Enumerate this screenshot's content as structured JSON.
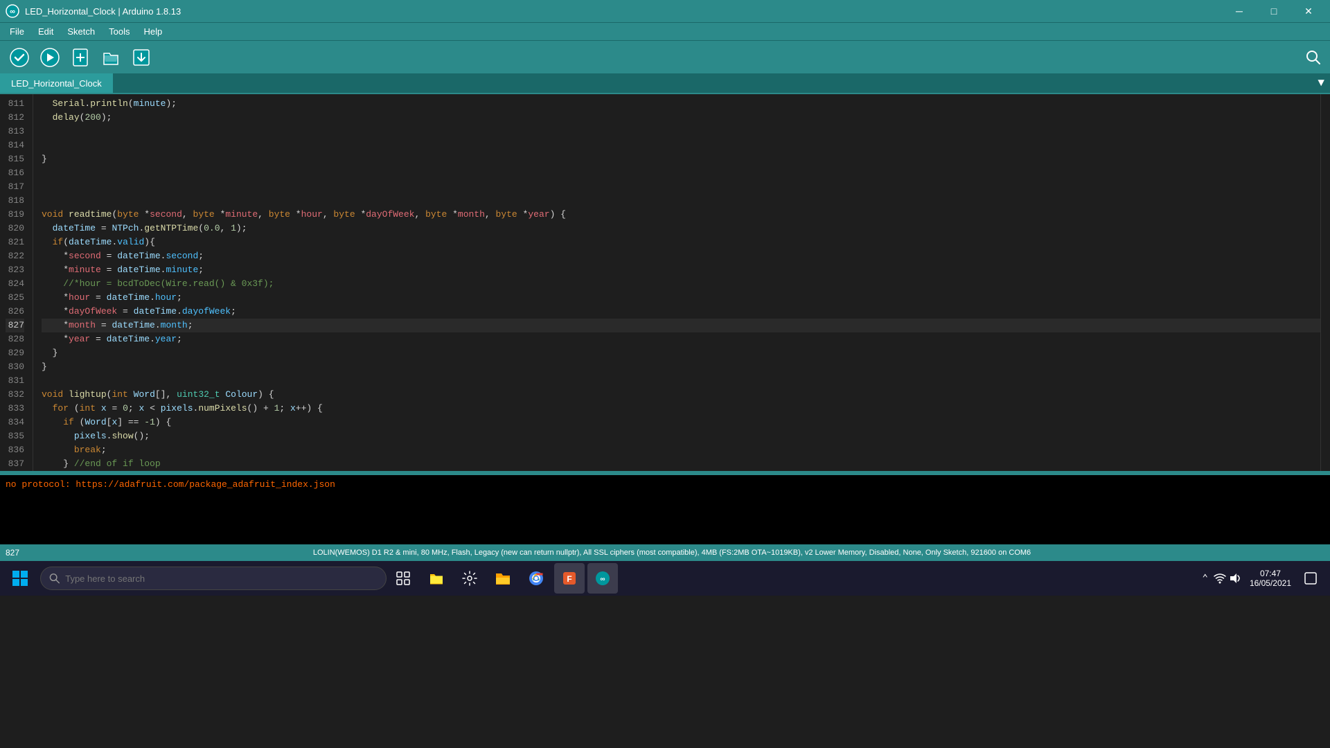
{
  "titlebar": {
    "title": "LED_Horizontal_Clock | Arduino 1.8.13",
    "icon": "arduino"
  },
  "window_controls": {
    "minimize": "─",
    "maximize": "□",
    "close": "✕"
  },
  "menu": {
    "items": [
      "File",
      "Edit",
      "Sketch",
      "Tools",
      "Help"
    ]
  },
  "tab": {
    "label": "LED_Horizontal_Clock",
    "active": true
  },
  "code_lines": [
    {
      "num": "811",
      "content": "  Serial.println(minute);"
    },
    {
      "num": "812",
      "content": "  delay(200);"
    },
    {
      "num": "813",
      "content": ""
    },
    {
      "num": "814",
      "content": ""
    },
    {
      "num": "815",
      "content": "}"
    },
    {
      "num": "816",
      "content": ""
    },
    {
      "num": "817",
      "content": ""
    },
    {
      "num": "818",
      "content": ""
    },
    {
      "num": "819",
      "content": "void readtime(byte *second, byte *minute, byte *hour, byte *dayOfWeek, byte *month, byte *year) {"
    },
    {
      "num": "820",
      "content": "  dateTime = NTPch.getNTPTime(0.0, 1);"
    },
    {
      "num": "821",
      "content": "  if(dateTime.valid){"
    },
    {
      "num": "822",
      "content": "    *second = dateTime.second;"
    },
    {
      "num": "823",
      "content": "    *minute = dateTime.minute;"
    },
    {
      "num": "824",
      "content": "    //*hour = bcdToDec(Wire.read() & 0x3f);"
    },
    {
      "num": "825",
      "content": "    *hour = dateTime.hour;"
    },
    {
      "num": "826",
      "content": "    *dayOfWeek = dateTime.dayofWeek;"
    },
    {
      "num": "827",
      "content": "    *month = dateTime.month;",
      "highlighted": true
    },
    {
      "num": "828",
      "content": "    *year = dateTime.year;"
    },
    {
      "num": "829",
      "content": "  }"
    },
    {
      "num": "830",
      "content": "}"
    },
    {
      "num": "831",
      "content": ""
    },
    {
      "num": "832",
      "content": "void lightup(int Word[], uint32_t Colour) {"
    },
    {
      "num": "833",
      "content": "  for (int x = 0; x < pixels.numPixels() + 1; x++) {"
    },
    {
      "num": "834",
      "content": "    if (Word[x] == -1) {"
    },
    {
      "num": "835",
      "content": "      pixels.show();"
    },
    {
      "num": "836",
      "content": "      break;"
    },
    {
      "num": "837",
      "content": "    } //end of if loop"
    }
  ],
  "console": {
    "text": "no protocol: https://adafruit.com/package_adafruit_index.json"
  },
  "status_bar": {
    "line": "827",
    "board_info": "LOLIN(WEMOS) D1 R2 & mini, 80 MHz, Flash, Legacy (new can return nullptr), All SSL ciphers (most compatible), 4MB (FS:2MB OTA~1019KB), v2 Lower Memory, Disabled, None, Only Sketch, 921600 on COM6"
  },
  "taskbar": {
    "search_placeholder": "Type here to search",
    "time": "07:47",
    "date": "16/05/2021"
  }
}
